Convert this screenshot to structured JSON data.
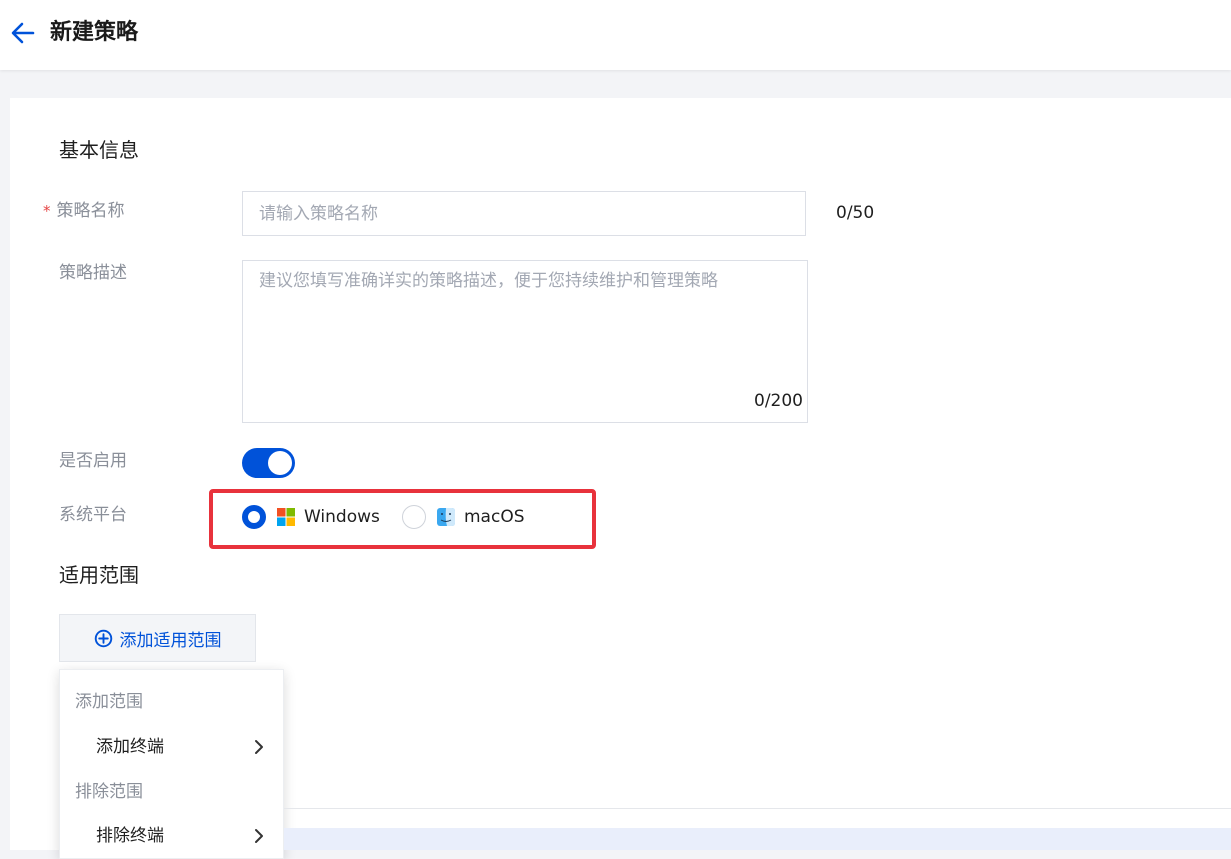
{
  "header": {
    "title": "新建策略"
  },
  "basic_info": {
    "section_title": "基本信息",
    "name": {
      "label": "策略名称",
      "required_mark": "*",
      "placeholder": "请输入策略名称",
      "value": "",
      "counter": "0/50"
    },
    "description": {
      "label": "策略描述",
      "placeholder": "建议您填写准确详实的策略描述，便于您持续维护和管理策略",
      "value": "",
      "counter": "0/200"
    },
    "enabled": {
      "label": "是否启用",
      "on": true
    },
    "platform": {
      "label": "系统平台",
      "options": [
        {
          "label": "Windows",
          "icon": "windows-icon",
          "selected": true
        },
        {
          "label": "macOS",
          "icon": "finder-icon",
          "selected": false
        }
      ]
    }
  },
  "scope": {
    "section_title": "适用范围",
    "add_button_label": "添加适用范围",
    "dropdown": {
      "add_group": "添加范围",
      "add_item": "添加终端",
      "exclude_group": "排除范围",
      "exclude_item": "排除终端"
    }
  },
  "colors": {
    "primary": "#0052d9",
    "highlight": "#e8323c",
    "required": "#e54545"
  }
}
